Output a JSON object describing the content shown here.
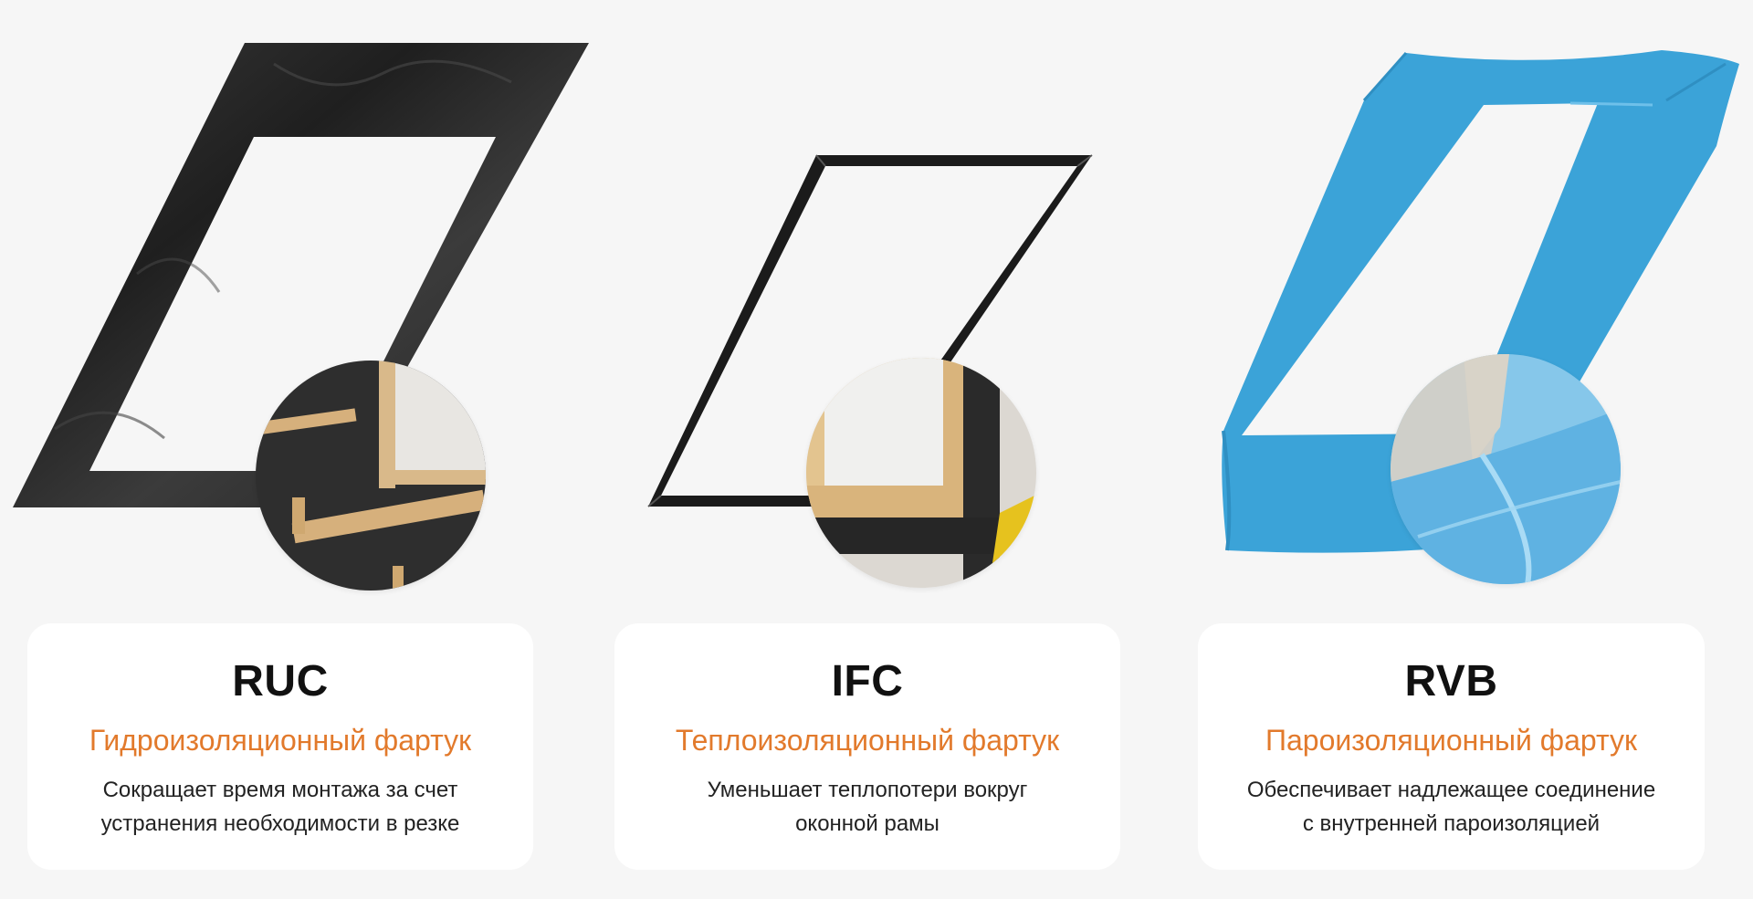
{
  "accent_color": "#e27a2c",
  "products": [
    {
      "code": "RUC",
      "subtitle": "Гидроизоляционный фартук",
      "description_line1": "Сокращает время монтажа за счет",
      "description_line2": "устранения необходимости в резке",
      "material_color": "#2b2b2b",
      "icon": "black-membrane-flashing-icon"
    },
    {
      "code": "IFC",
      "subtitle": "Теплоизоляционный фартук",
      "description_line1": "Уменьшает теплопотери вокруг",
      "description_line2": "оконной рамы",
      "material_color": "#1a1a1a",
      "icon": "insulation-frame-icon"
    },
    {
      "code": "RVB",
      "subtitle": "Пароизоляционный фартук",
      "description_line1": "Обеспечивает надлежащее соединение",
      "description_line2": "с внутренней пароизоляцией",
      "material_color": "#3ba3d8",
      "icon": "vapour-barrier-collar-icon"
    }
  ]
}
